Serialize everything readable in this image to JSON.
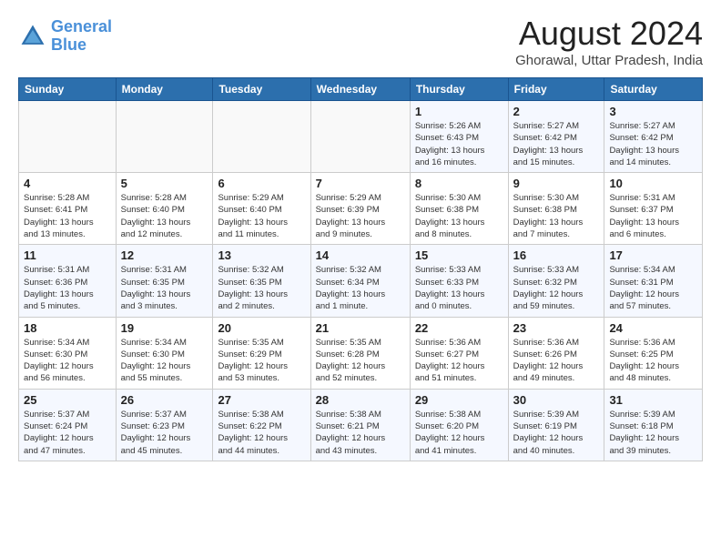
{
  "header": {
    "logo_line1": "General",
    "logo_line2": "Blue",
    "month_year": "August 2024",
    "location": "Ghorawal, Uttar Pradesh, India"
  },
  "weekdays": [
    "Sunday",
    "Monday",
    "Tuesday",
    "Wednesday",
    "Thursday",
    "Friday",
    "Saturday"
  ],
  "weeks": [
    [
      {
        "day": "",
        "detail": ""
      },
      {
        "day": "",
        "detail": ""
      },
      {
        "day": "",
        "detail": ""
      },
      {
        "day": "",
        "detail": ""
      },
      {
        "day": "1",
        "detail": "Sunrise: 5:26 AM\nSunset: 6:43 PM\nDaylight: 13 hours\nand 16 minutes."
      },
      {
        "day": "2",
        "detail": "Sunrise: 5:27 AM\nSunset: 6:42 PM\nDaylight: 13 hours\nand 15 minutes."
      },
      {
        "day": "3",
        "detail": "Sunrise: 5:27 AM\nSunset: 6:42 PM\nDaylight: 13 hours\nand 14 minutes."
      }
    ],
    [
      {
        "day": "4",
        "detail": "Sunrise: 5:28 AM\nSunset: 6:41 PM\nDaylight: 13 hours\nand 13 minutes."
      },
      {
        "day": "5",
        "detail": "Sunrise: 5:28 AM\nSunset: 6:40 PM\nDaylight: 13 hours\nand 12 minutes."
      },
      {
        "day": "6",
        "detail": "Sunrise: 5:29 AM\nSunset: 6:40 PM\nDaylight: 13 hours\nand 11 minutes."
      },
      {
        "day": "7",
        "detail": "Sunrise: 5:29 AM\nSunset: 6:39 PM\nDaylight: 13 hours\nand 9 minutes."
      },
      {
        "day": "8",
        "detail": "Sunrise: 5:30 AM\nSunset: 6:38 PM\nDaylight: 13 hours\nand 8 minutes."
      },
      {
        "day": "9",
        "detail": "Sunrise: 5:30 AM\nSunset: 6:38 PM\nDaylight: 13 hours\nand 7 minutes."
      },
      {
        "day": "10",
        "detail": "Sunrise: 5:31 AM\nSunset: 6:37 PM\nDaylight: 13 hours\nand 6 minutes."
      }
    ],
    [
      {
        "day": "11",
        "detail": "Sunrise: 5:31 AM\nSunset: 6:36 PM\nDaylight: 13 hours\nand 5 minutes."
      },
      {
        "day": "12",
        "detail": "Sunrise: 5:31 AM\nSunset: 6:35 PM\nDaylight: 13 hours\nand 3 minutes."
      },
      {
        "day": "13",
        "detail": "Sunrise: 5:32 AM\nSunset: 6:35 PM\nDaylight: 13 hours\nand 2 minutes."
      },
      {
        "day": "14",
        "detail": "Sunrise: 5:32 AM\nSunset: 6:34 PM\nDaylight: 13 hours\nand 1 minute."
      },
      {
        "day": "15",
        "detail": "Sunrise: 5:33 AM\nSunset: 6:33 PM\nDaylight: 13 hours\nand 0 minutes."
      },
      {
        "day": "16",
        "detail": "Sunrise: 5:33 AM\nSunset: 6:32 PM\nDaylight: 12 hours\nand 59 minutes."
      },
      {
        "day": "17",
        "detail": "Sunrise: 5:34 AM\nSunset: 6:31 PM\nDaylight: 12 hours\nand 57 minutes."
      }
    ],
    [
      {
        "day": "18",
        "detail": "Sunrise: 5:34 AM\nSunset: 6:30 PM\nDaylight: 12 hours\nand 56 minutes."
      },
      {
        "day": "19",
        "detail": "Sunrise: 5:34 AM\nSunset: 6:30 PM\nDaylight: 12 hours\nand 55 minutes."
      },
      {
        "day": "20",
        "detail": "Sunrise: 5:35 AM\nSunset: 6:29 PM\nDaylight: 12 hours\nand 53 minutes."
      },
      {
        "day": "21",
        "detail": "Sunrise: 5:35 AM\nSunset: 6:28 PM\nDaylight: 12 hours\nand 52 minutes."
      },
      {
        "day": "22",
        "detail": "Sunrise: 5:36 AM\nSunset: 6:27 PM\nDaylight: 12 hours\nand 51 minutes."
      },
      {
        "day": "23",
        "detail": "Sunrise: 5:36 AM\nSunset: 6:26 PM\nDaylight: 12 hours\nand 49 minutes."
      },
      {
        "day": "24",
        "detail": "Sunrise: 5:36 AM\nSunset: 6:25 PM\nDaylight: 12 hours\nand 48 minutes."
      }
    ],
    [
      {
        "day": "25",
        "detail": "Sunrise: 5:37 AM\nSunset: 6:24 PM\nDaylight: 12 hours\nand 47 minutes."
      },
      {
        "day": "26",
        "detail": "Sunrise: 5:37 AM\nSunset: 6:23 PM\nDaylight: 12 hours\nand 45 minutes."
      },
      {
        "day": "27",
        "detail": "Sunrise: 5:38 AM\nSunset: 6:22 PM\nDaylight: 12 hours\nand 44 minutes."
      },
      {
        "day": "28",
        "detail": "Sunrise: 5:38 AM\nSunset: 6:21 PM\nDaylight: 12 hours\nand 43 minutes."
      },
      {
        "day": "29",
        "detail": "Sunrise: 5:38 AM\nSunset: 6:20 PM\nDaylight: 12 hours\nand 41 minutes."
      },
      {
        "day": "30",
        "detail": "Sunrise: 5:39 AM\nSunset: 6:19 PM\nDaylight: 12 hours\nand 40 minutes."
      },
      {
        "day": "31",
        "detail": "Sunrise: 5:39 AM\nSunset: 6:18 PM\nDaylight: 12 hours\nand 39 minutes."
      }
    ]
  ]
}
